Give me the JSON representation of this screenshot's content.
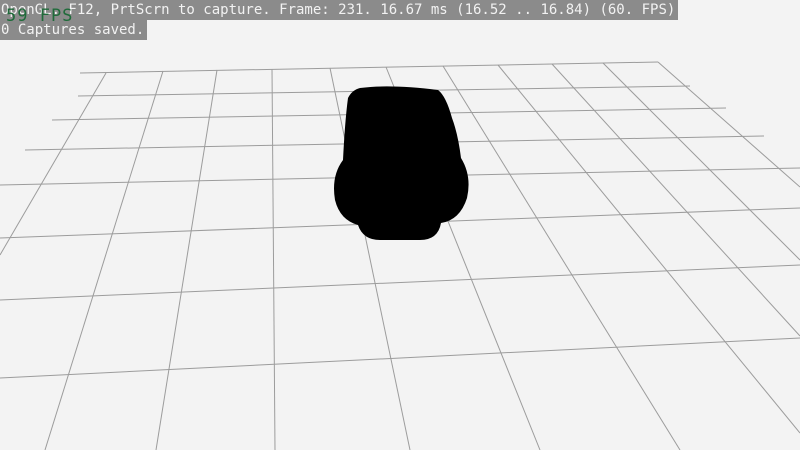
{
  "overlay": {
    "status_line": "OpenGL. F12, PrtScrn to capture. Frame: 231. 16.67 ms (16.52 .. 16.84) (60. FPS)",
    "captures_line": "0 Captures saved.",
    "fps_counter": "59 FPS"
  },
  "scene": {
    "background_color": "#f3f3f3",
    "grid_line_color": "#9c9c9c",
    "object_color": "#000000",
    "object_shape": "car-silhouette"
  }
}
